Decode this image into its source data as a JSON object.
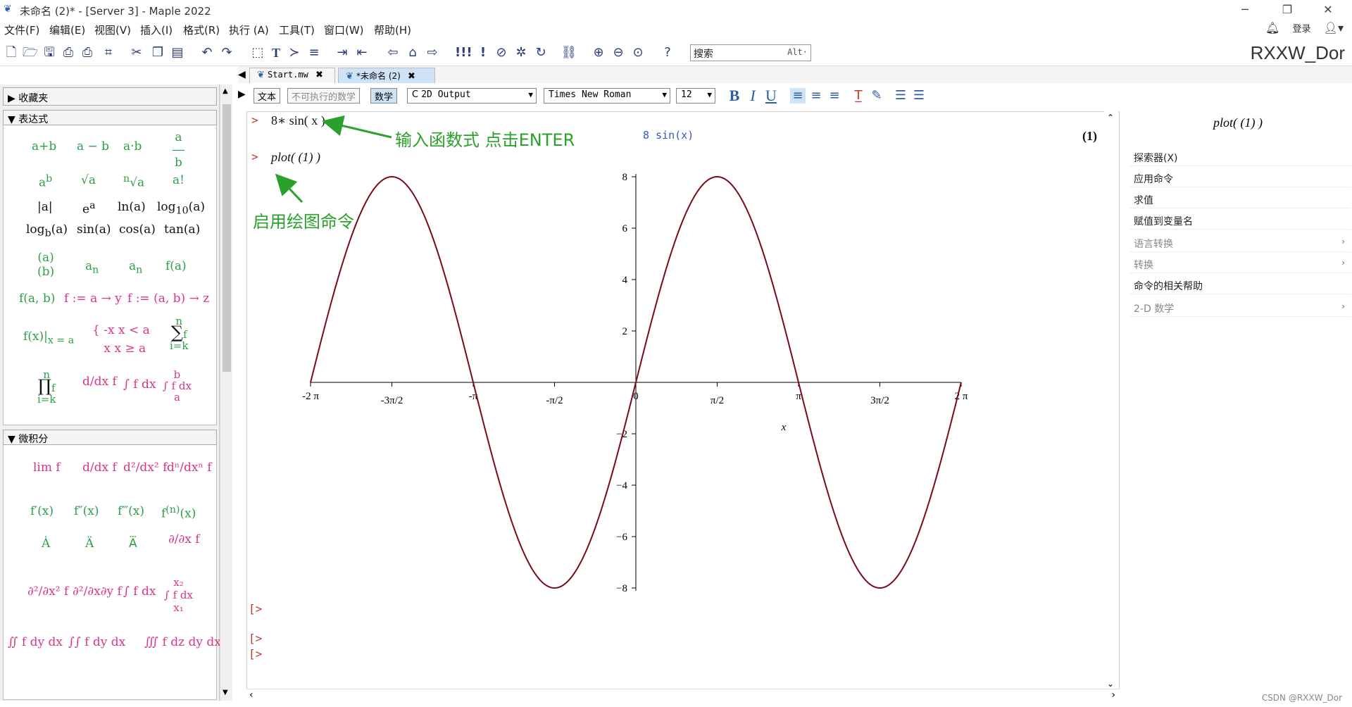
{
  "window": {
    "title": "未命名 (2)* - [Server 3] - Maple 2022",
    "brand": "RXXW_Dor",
    "login_label": "登录"
  },
  "menu": [
    "文件(F)",
    "编辑(E)",
    "视图(V)",
    "插入(I)",
    "格式(R)",
    "执行 (A)",
    "工具(T)",
    "窗口(W)",
    "帮助(H)"
  ],
  "search": {
    "placeholder": "搜索",
    "hint": "Alt·"
  },
  "palette": {
    "sections": [
      {
        "label": "收藏夹",
        "collapsed": true
      },
      {
        "label": "表达式",
        "collapsed": false
      },
      {
        "label": "微积分",
        "collapsed": false
      }
    ]
  },
  "tabs": [
    {
      "label": "Start.mw"
    },
    {
      "label": "*未命名 (2)"
    }
  ],
  "format": {
    "text_btn": "文本",
    "nonexec_btn": "不可执行的数学",
    "math_btn": "数学",
    "style": "2D Output",
    "font": "Times New Roman",
    "size": "12"
  },
  "worksheet": {
    "input1": "8∗ sin( x )",
    "output1": "8 sin(x)",
    "eq_label": "(1)",
    "input2": "plot( (1) )",
    "annotation1": "输入函数式 点击ENTER",
    "annotation2": "启用绘图命令"
  },
  "chart_data": {
    "type": "line",
    "title": "",
    "xlabel": "x",
    "ylabel": "",
    "function": "8 sin(x)",
    "xlim": [
      -6.2832,
      6.2832
    ],
    "ylim": [
      -8,
      8
    ],
    "xticks": [
      "-2 π",
      "-3π/2",
      "-π",
      "-π/2",
      "0",
      "π/2",
      "π",
      "3π/2",
      "2 π"
    ],
    "yticks": [
      "8",
      "6",
      "4",
      "2",
      "-2",
      "-4",
      "-6",
      "-8"
    ],
    "color": "#7a0a1a",
    "series": [
      {
        "x": [
          -6.28,
          -5.5,
          -4.71,
          -3.93,
          -3.14,
          -2.36,
          -1.57,
          -0.79,
          0,
          0.79,
          1.57,
          2.36,
          3.14,
          3.93,
          4.71,
          5.5,
          6.28
        ],
        "values": [
          0,
          5.66,
          8,
          5.66,
          0,
          -5.66,
          -8,
          -5.66,
          0,
          5.66,
          8,
          5.66,
          0,
          -5.66,
          -8,
          -5.66,
          0
        ]
      }
    ]
  },
  "context": {
    "header": "plot( (1) )",
    "items": [
      {
        "label": "探索器(X)",
        "dim": false,
        "sub": false
      },
      {
        "label": "应用命令",
        "dim": false,
        "sub": false
      },
      {
        "label": "求值",
        "dim": false,
        "sub": false
      },
      {
        "label": "赋值到变量名",
        "dim": false,
        "sub": false
      },
      {
        "label": "语言转换",
        "dim": true,
        "sub": true
      },
      {
        "label": "转换",
        "dim": true,
        "sub": true
      },
      {
        "label": "命令的相关帮助",
        "dim": false,
        "sub": false
      },
      {
        "label": "2-D 数学",
        "dim": true,
        "sub": true
      }
    ]
  },
  "watermark": "CSDN @RXXW_Dor"
}
